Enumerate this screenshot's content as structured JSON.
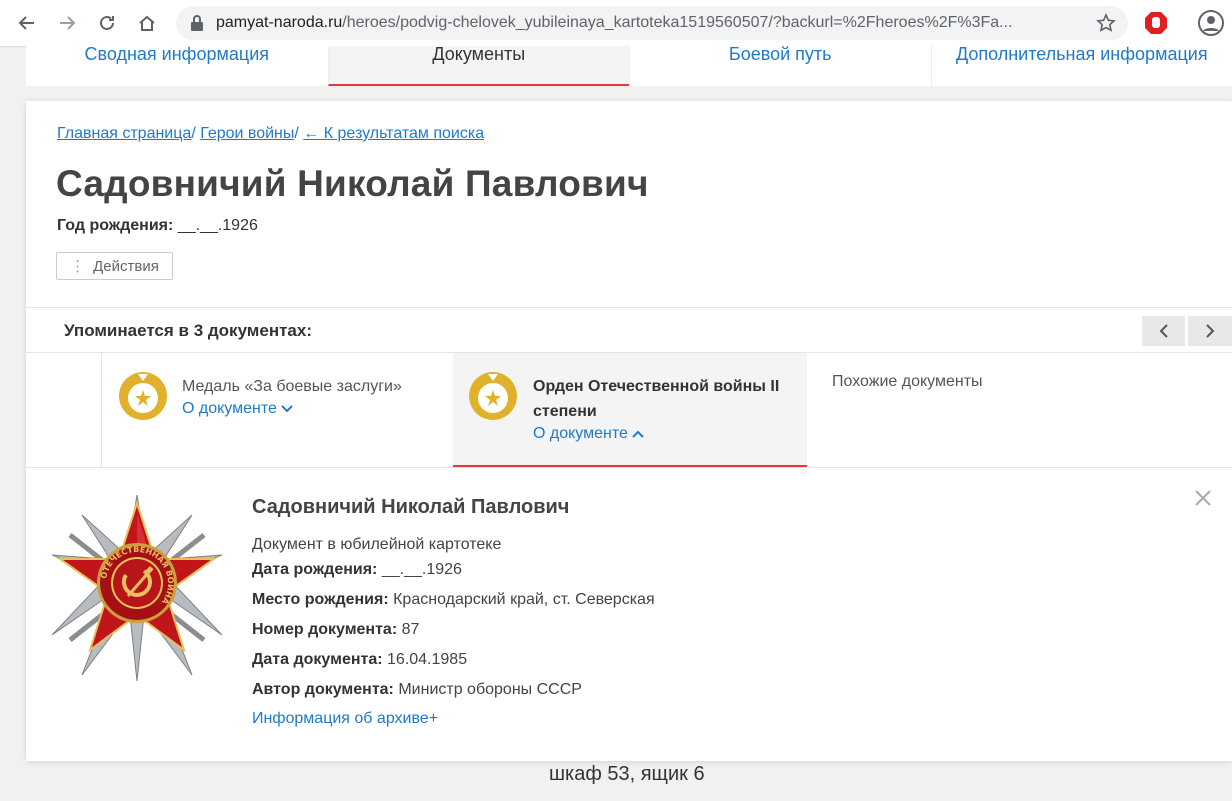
{
  "browser": {
    "url_host": "pamyat-naroda.ru",
    "url_path": "/heroes/podvig-chelovek_yubileinaya_kartoteka1519560507/?backurl=%2Fheroes%2F%3Fa..."
  },
  "tabs": [
    {
      "label": "Сводная информация"
    },
    {
      "label": "Документы"
    },
    {
      "label": "Боевой путь"
    },
    {
      "label": "Дополнительная информация"
    }
  ],
  "breadcrumb": {
    "home": "Главная страница",
    "sep1": "/",
    "heroes": "Герои войны",
    "sep2": "/",
    "back": "← К результатам поиска"
  },
  "hero": {
    "name": "Садовничий Николай Павлович",
    "birth_label": "Год рождения:",
    "birth_value": "__.__.1926"
  },
  "actions": {
    "label": "Действия"
  },
  "mentions": {
    "text": "Упоминается в 3 документах:"
  },
  "documents": [
    {
      "title": "Медаль «За боевые заслуги»",
      "link": "О документе"
    },
    {
      "title_line1": "Орден Отечественной войны II",
      "title_line2": "степени",
      "link": "О документе"
    }
  ],
  "similar": {
    "label": "Похожие документы"
  },
  "detail": {
    "name": "Садовничий Николай Павлович",
    "type": "Документ в юбилейной картотеке",
    "fields": [
      {
        "label": "Дата рождения:",
        "value": "__.__.1926"
      },
      {
        "label": "Место рождения:",
        "value": "Краснодарский край, ст. Северская"
      },
      {
        "label": "Номер документа:",
        "value": "87"
      },
      {
        "label": "Дата документа:",
        "value": "16.04.1985"
      },
      {
        "label": "Автор документа:",
        "value": "Министр обороны СССР"
      }
    ],
    "archive_link": "Информация об архиве+",
    "order_ring_text": "ОТЕЧЕСТВЕННАЯ ВОЙНА"
  },
  "footer": {
    "text": "шкаф 53, ящик 6"
  },
  "colors": {
    "accent": "#1f7acc",
    "active_underline": "#e53935",
    "medal_gold": "#e1b12c"
  }
}
